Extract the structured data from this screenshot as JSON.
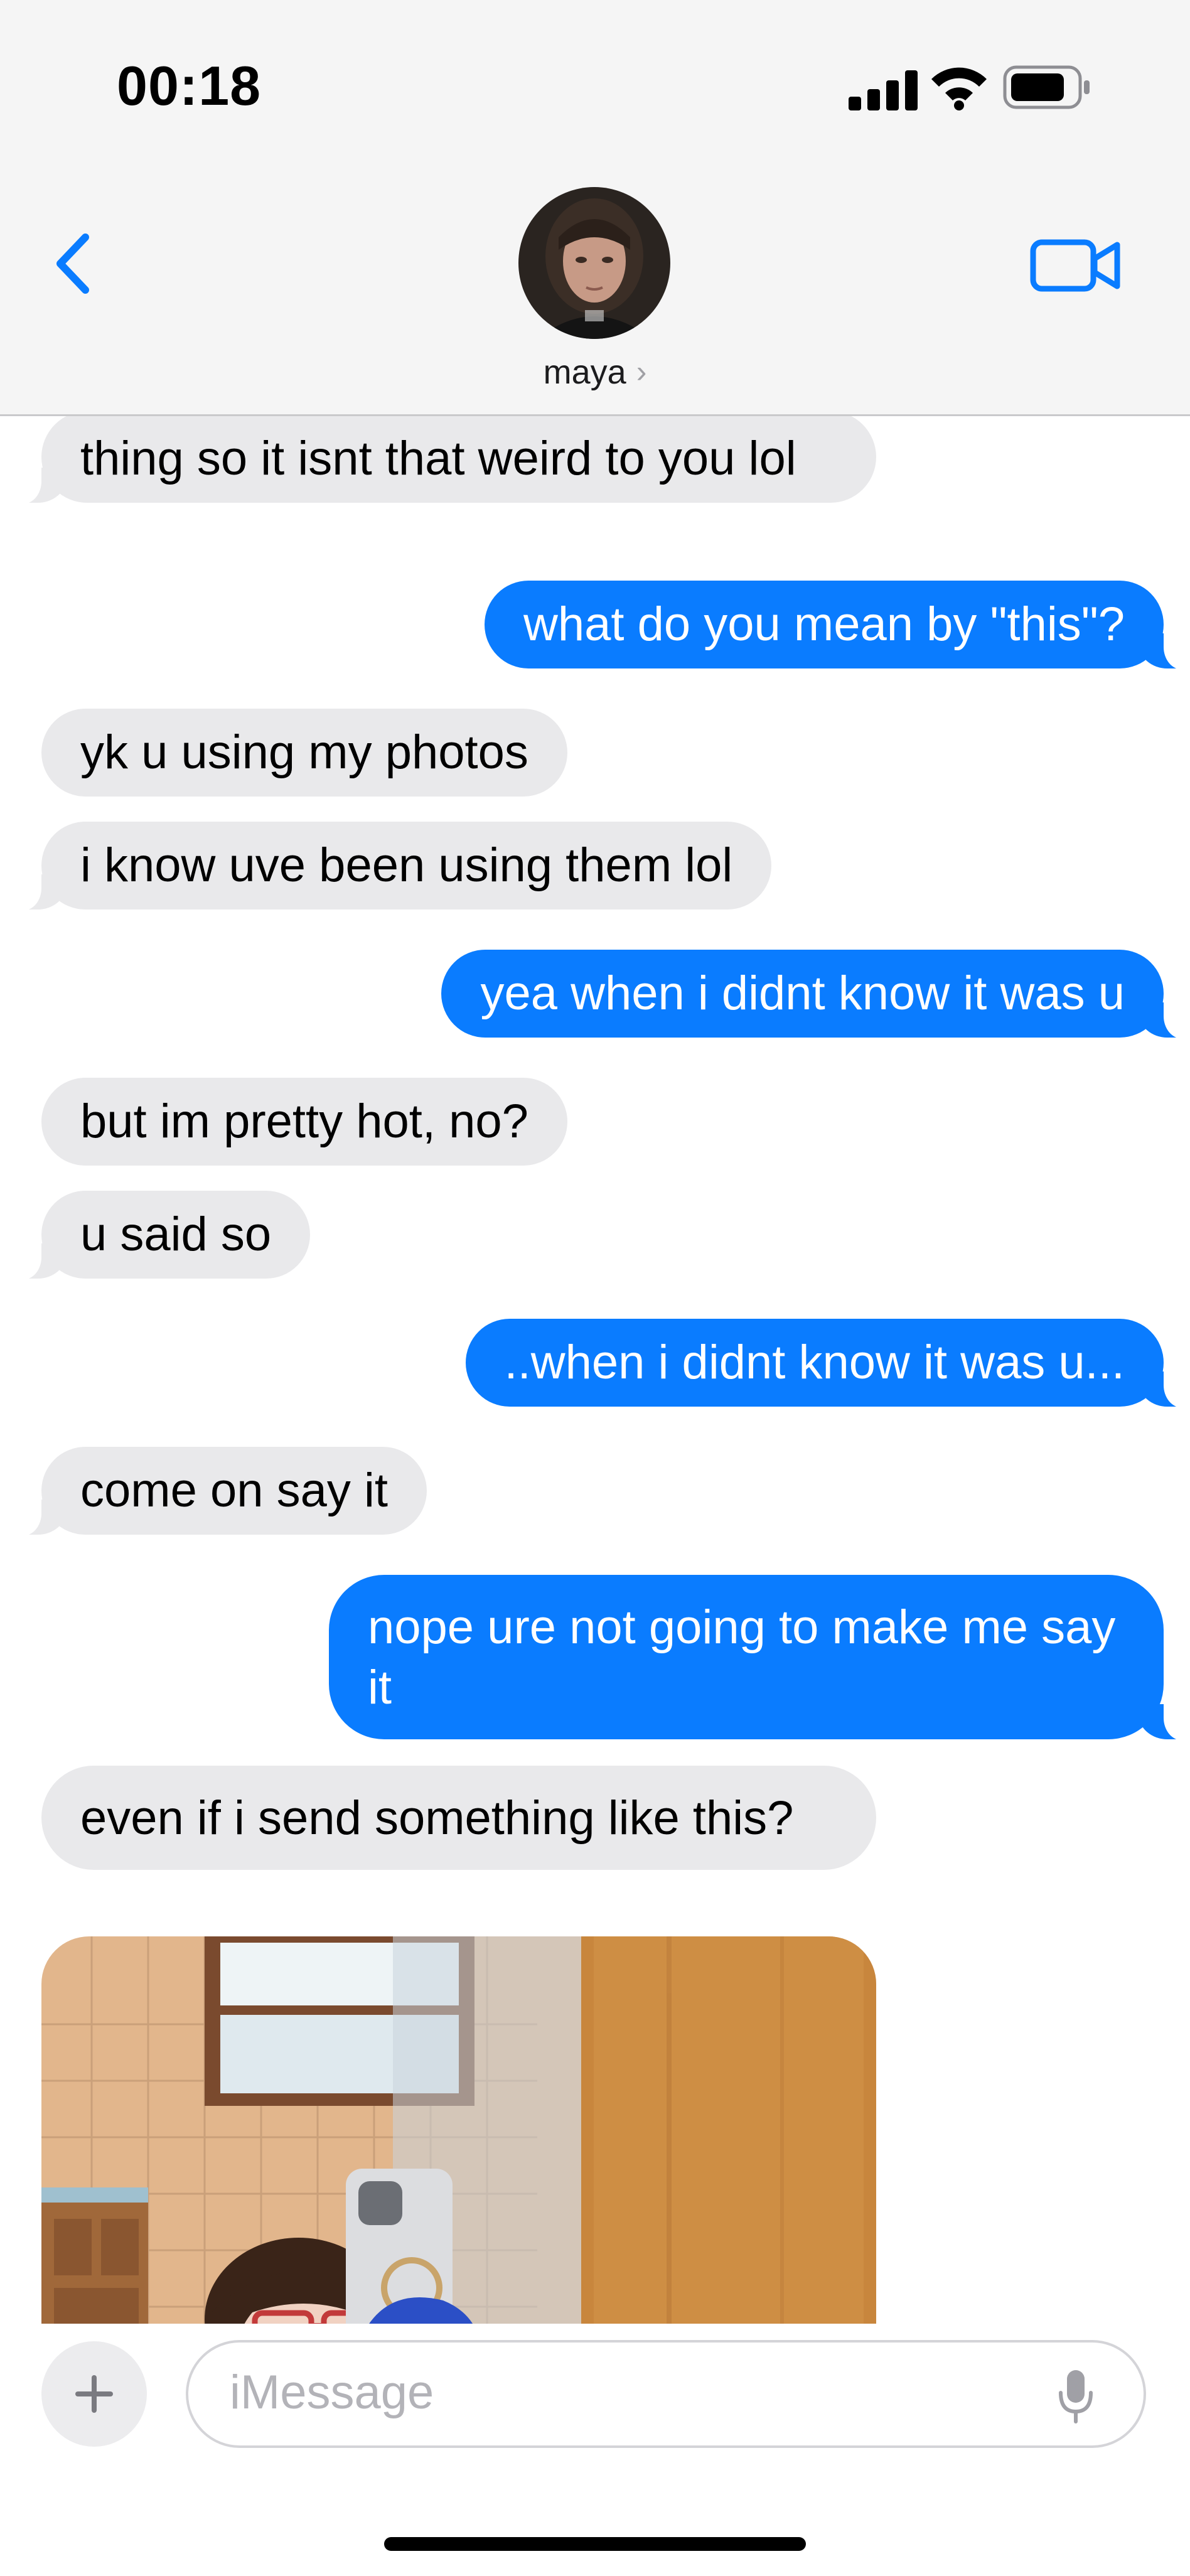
{
  "status_bar": {
    "time": "00:18"
  },
  "header": {
    "contact_name": "maya",
    "contact_chevron": "›",
    "back_icon": "chevron-left-icon",
    "video_icon": "video-camera-icon",
    "accent_color": "#0a7cff"
  },
  "messages": [
    {
      "direction": "incoming",
      "text": "thing so it isnt that weird to you lol"
    },
    {
      "direction": "outgoing",
      "text": "what do you mean by \"this\"?"
    },
    {
      "direction": "incoming",
      "text": "yk u using my photos"
    },
    {
      "direction": "incoming",
      "text": "i know uve been using them lol"
    },
    {
      "direction": "outgoing",
      "text": "yea when i didnt know it was u"
    },
    {
      "direction": "incoming",
      "text": "but im pretty hot, no?"
    },
    {
      "direction": "incoming",
      "text": "u said so"
    },
    {
      "direction": "outgoing",
      "text": "..when i didnt know it was u..."
    },
    {
      "direction": "incoming",
      "text": "come on say it"
    },
    {
      "direction": "outgoing",
      "text": "nope ure not going to make me say it"
    },
    {
      "direction": "incoming",
      "text": "even if i send something like this?"
    },
    {
      "direction": "incoming",
      "type": "photo",
      "text": ""
    }
  ],
  "compose": {
    "placeholder": "iMessage",
    "plus_icon": "plus-icon",
    "mic_icon": "microphone-icon"
  },
  "colors": {
    "incoming_bubble": "#e9e9eb",
    "outgoing_bubble": "#0a7cff",
    "header_background": "#f5f5f5"
  }
}
